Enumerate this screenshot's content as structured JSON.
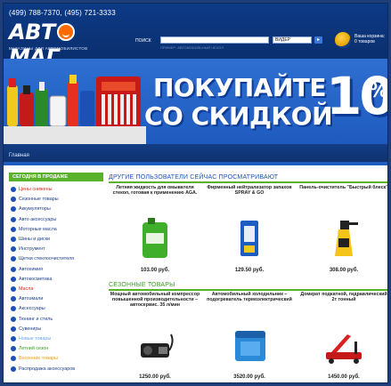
{
  "header": {
    "phone": "(499) 788-7370, (495) 721-3333",
    "logo_text": "АВТ",
    "logo_text2": "МАГ",
    "tagline": "МАГАЗИНЫ ДЛЯ АВТОМОБИЛИСТОВ",
    "search_label": "ПОИСК",
    "search_value": "",
    "search_select": "ВИДЕР",
    "search_go": "▸",
    "search_hint": "ПРИМЕР: АВТОМОБИЛЬНЫЙ ЧЕХОЛ",
    "cart_label": "Ваша корзина: 0 товаров",
    "cart_icon": "basket-icon"
  },
  "banner": {
    "line1": "ПОКУПАЙТЕ",
    "line2": "СО СКИДКОЙ",
    "percent": "10",
    "percent_sign": "%"
  },
  "breadcrumb": "Главная",
  "sidebar": {
    "title": "СЕГОДНЯ В ПРОДАЖЕ",
    "items": [
      {
        "label": "Цены снижены",
        "color": "#d42a1a"
      },
      {
        "label": "Сезонные товары",
        "color": "#1d3e8c"
      },
      {
        "label": "Аккумуляторы",
        "color": "#1d3e8c"
      },
      {
        "label": "Авто аксессуары",
        "color": "#1d3e8c"
      },
      {
        "label": "Моторные масла",
        "color": "#1d3e8c"
      },
      {
        "label": "Шины и диски",
        "color": "#1d3e8c"
      },
      {
        "label": "Инструмент",
        "color": "#1d3e8c"
      },
      {
        "label": "Щетки стеклоочистителя",
        "color": "#1d3e8c"
      },
      {
        "label": "Автохимия",
        "color": "#1d3e8c"
      },
      {
        "label": "Автокосметика",
        "color": "#1d3e8c"
      },
      {
        "label": "Масла",
        "color": "#d42a1a"
      },
      {
        "label": "Автоэмали",
        "color": "#1d3e8c"
      },
      {
        "label": "Аксессуары",
        "color": "#1d3e8c"
      },
      {
        "label": "Тюнинг и стиль",
        "color": "#1d3e8c"
      },
      {
        "label": "Сувениры",
        "color": "#1d3e8c"
      },
      {
        "label": "Новые товары",
        "color": "#6aa7e8"
      },
      {
        "label": "Летний сезон",
        "color": "#3aa020"
      },
      {
        "label": "Весенние товары",
        "color": "#e6a000"
      },
      {
        "label": "Распродажа аксессуаров",
        "color": "#1d3e8c"
      }
    ]
  },
  "main": {
    "section1_title": "ДРУГИЕ ПОЛЬЗОВАТЕЛИ СЕЙЧАС ПРОСМАТРИВАЮТ",
    "section2_title": "СЕЗОННЫЕ ТОВАРЫ",
    "products": [
      {
        "name": "Летняя жидкость для омывателя стекол, готовая к применению AGA.",
        "price": "103.00 руб.",
        "image": "green-canister"
      },
      {
        "name": "Фирменный нейтрализатор запахов SPRAY & GO",
        "price": "129.50 руб.",
        "image": "air-freshener"
      },
      {
        "name": "Панель-очиститель \"Быстрый блеск\"",
        "price": "308.00 руб.",
        "image": "yellow-spray-bottle"
      },
      {
        "name": "Мощный автомобильный компрессор повышенной производительности – автосервис. 35 л/мин",
        "price": "1250.00 руб.",
        "image": "air-compressor"
      },
      {
        "name": "Автомобильный холодильник – подогреватель термоэлектрический",
        "price": "3520.00 руб.",
        "image": "car-cooler"
      },
      {
        "name": "Домкрат подкатной, гидравлический 2т тонный",
        "price": "1450.00 руб.",
        "image": "floor-jack"
      }
    ]
  }
}
